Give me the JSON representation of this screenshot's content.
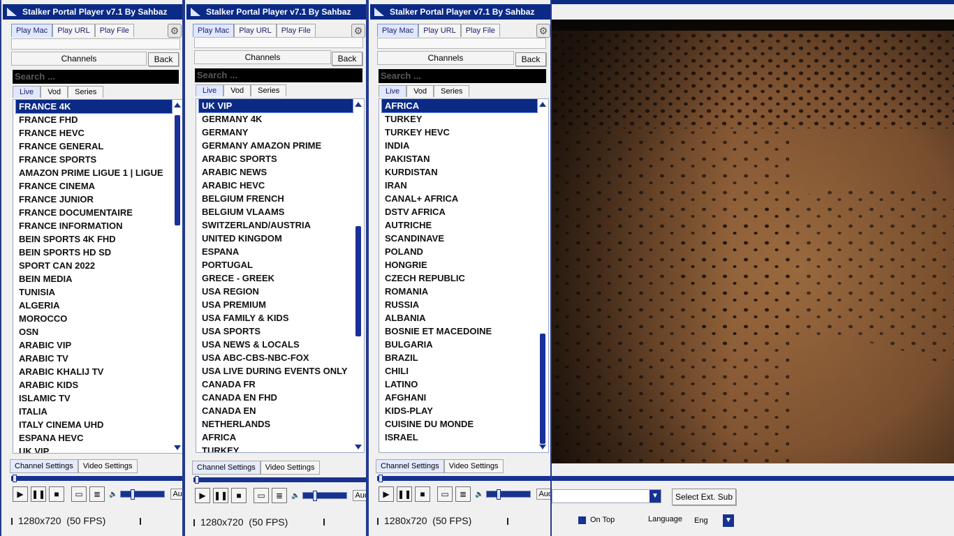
{
  "app_title": "Stalker Portal Player v7.1 By Sahbaz",
  "top_tabs": [
    "Play Mac",
    "Play URL",
    "Play File"
  ],
  "channels_label": "Channels",
  "back_label": "Back",
  "search_placeholder": "Search ...",
  "sub_tabs": [
    "Live",
    "Vod",
    "Series"
  ],
  "bottom_tabs": [
    "Channel Settings",
    "Video Settings"
  ],
  "audio_label": "Audio",
  "resolution_text": "1280x720",
  "fps_text": "(50 FPS)",
  "panels": [
    {
      "selected": "FRANCE 4K",
      "items": [
        "FRANCE 4K",
        "FRANCE FHD",
        "FRANCE HEVC",
        "FRANCE GENERAL",
        "FRANCE SPORTS",
        "AMAZON PRIME LIGUE 1 | LIGUE",
        "FRANCE CINEMA",
        "FRANCE JUNIOR",
        "FRANCE DOCUMENTAIRE",
        "FRANCE INFORMATION",
        "BEIN SPORTS 4K FHD",
        "BEIN SPORTS HD SD",
        "SPORT CAN 2022",
        "BEIN MEDIA",
        "TUNISIA",
        "ALGERIA",
        "MOROCCO",
        "OSN",
        "ARABIC VIP",
        "ARABIC TV",
        "ARABIC KHALIJ TV",
        "ARABIC KIDS",
        "ISLAMIC TV",
        "ITALIA",
        "ITALY CINEMA UHD",
        "ESPANA HEVC",
        "UK VIP"
      ],
      "scroll_position": 0.0,
      "scroll_visible": 0.32
    },
    {
      "selected": "UK VIP",
      "items": [
        "UK VIP",
        "GERMANY 4K",
        "GERMANY",
        "GERMANY AMAZON PRIME",
        "ARABIC SPORTS",
        "ARABIC NEWS",
        "ARABIC HEVC",
        "BELGIUM FRENCH",
        "BELGIUM VLAAMS",
        "SWITZERLAND/AUSTRIA",
        "UNITED KINGDOM",
        "ESPANA",
        "PORTUGAL",
        "GRECE - GREEK",
        "USA REGION",
        "USA PREMIUM",
        "USA FAMILY & KIDS",
        "USA SPORTS",
        "USA NEWS & LOCALS",
        "USA  ABC-CBS-NBC-FOX",
        "USA LIVE DURING EVENTS ONLY",
        "CANADA FR",
        "CANADA EN FHD",
        "CANADA EN",
        "NETHERLANDS",
        "AFRICA",
        "TURKEY"
      ],
      "scroll_position": 0.38,
      "scroll_visible": 0.32
    },
    {
      "selected": "AFRICA",
      "items": [
        "AFRICA",
        "TURKEY",
        "TURKEY HEVC",
        "INDIA",
        "PAKISTAN",
        "KURDISTAN",
        "IRAN",
        "CANAL+ AFRICA",
        "DSTV AFRICA",
        "AUTRICHE",
        "SCANDINAVE",
        "POLAND",
        "HONGRIE",
        "CZECH REPUBLIC",
        "ROMANIA",
        "RUSSIA",
        "ALBANIA",
        "BOSNIE ET MACEDOINE",
        "BULGARIA",
        "BRAZIL",
        "CHILI",
        "LATINO",
        "AFGHANI",
        "KIDS-PLAY",
        "CUISINE DU MONDE",
        "ISRAEL"
      ],
      "scroll_position": 0.68,
      "scroll_visible": 0.32
    }
  ],
  "right_controls": {
    "select_ext_sub_label": "Select Ext. Sub",
    "on_top_label": "On Top",
    "language_label": "Language",
    "language_value": "Eng"
  },
  "colors": {
    "accent": "#0b2a86",
    "selection": "#0a2a86",
    "search_bg": "#000000"
  }
}
